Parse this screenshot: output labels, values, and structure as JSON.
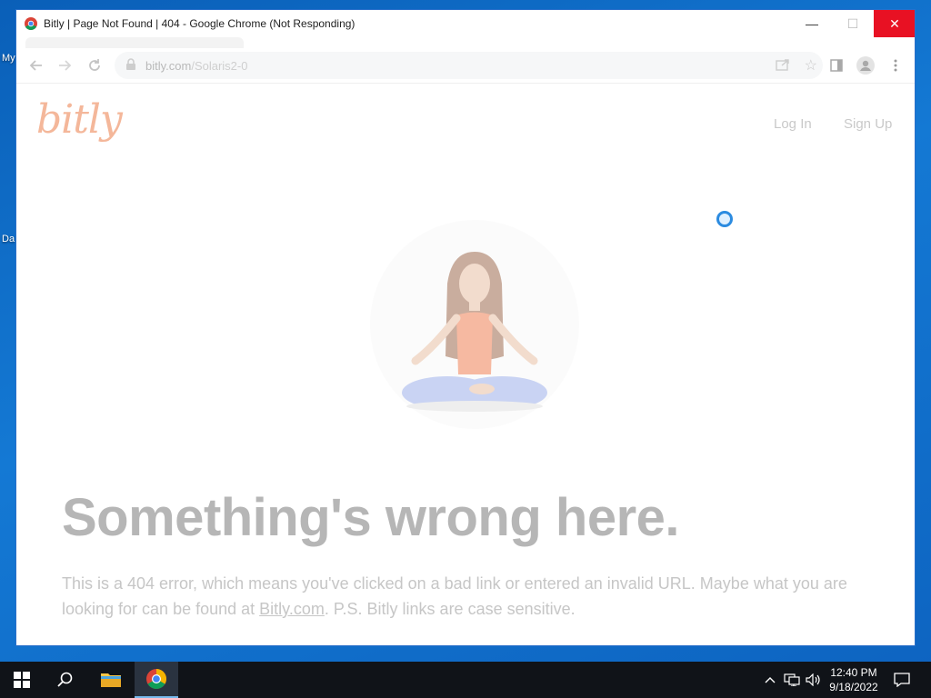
{
  "desktop": {
    "labels": [
      "My",
      "Da"
    ]
  },
  "window": {
    "title": "Bitly | Page Not Found | 404 - Google Chrome (Not Responding)",
    "controls": {
      "minimize": "—",
      "maximize": "☐",
      "close": "✕"
    }
  },
  "toolbar": {
    "url_host": "bitly.com",
    "url_path": "/Solaris2-0"
  },
  "page": {
    "logo": "bitly",
    "nav": {
      "login": "Log In",
      "signup": "Sign Up"
    },
    "headline": "Something's wrong here.",
    "body_before_link": "This is a 404 error, which means you've clicked on a bad link or entered an invalid URL. Maybe what you are looking for can be found at ",
    "body_link": "Bitly.com",
    "body_after_link": ". P.S. Bitly links are case sensitive."
  },
  "taskbar": {
    "time": "12:40 PM",
    "date": "9/18/2022"
  },
  "colors": {
    "close_red": "#e81123",
    "logo_peach": "#f4b79a",
    "taskbar": "#101318",
    "desktop_blue": "#1479d4"
  }
}
